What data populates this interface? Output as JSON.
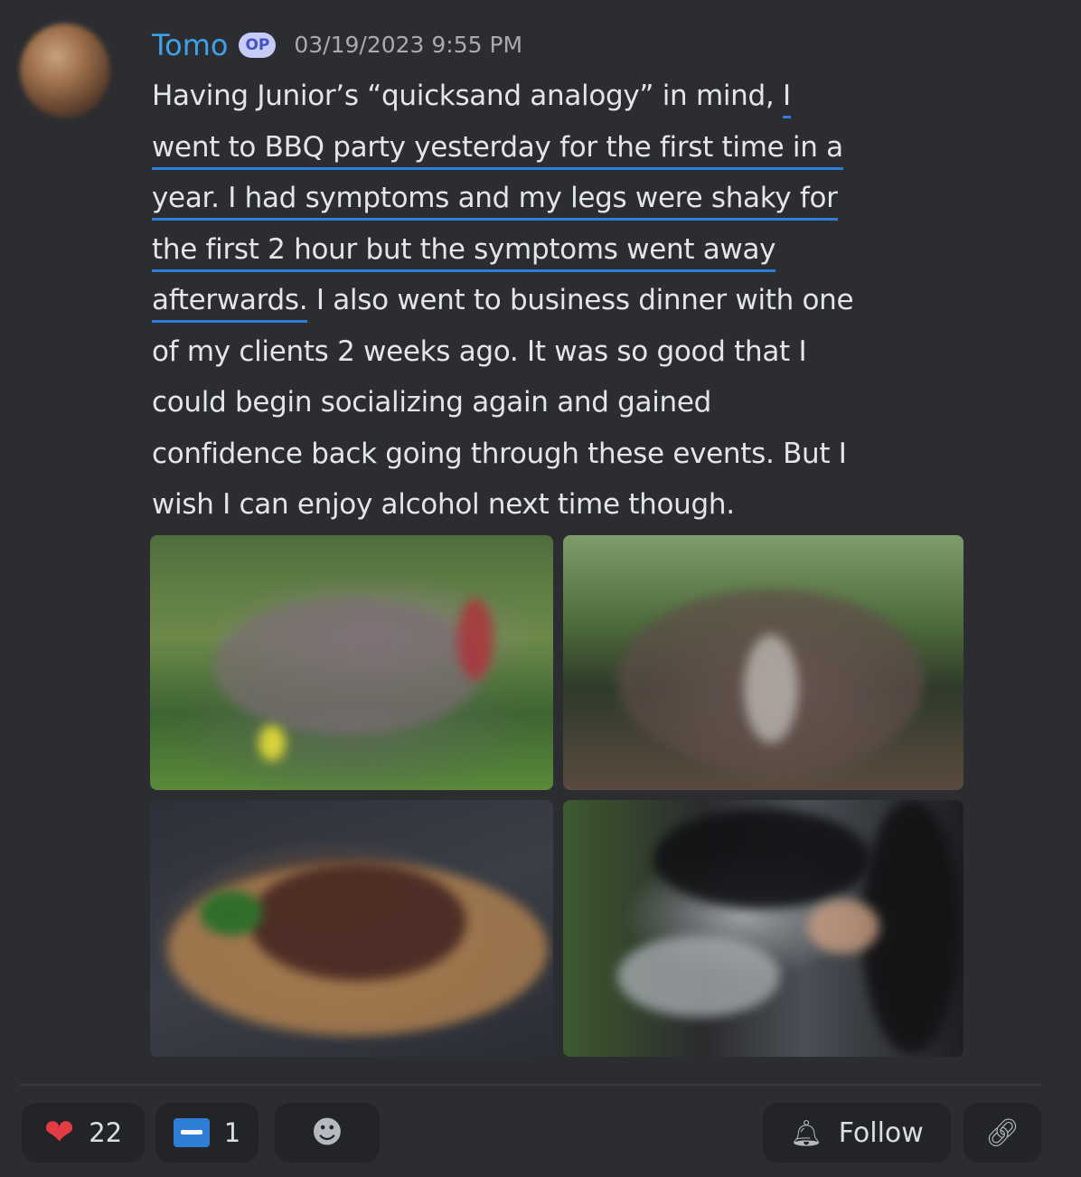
{
  "post": {
    "username": "Tomo",
    "badge": "OP",
    "timestamp": "03/19/2023 9:55 PM",
    "lines": [
      "Having Junior’s “quicksand analogy” in mind, ",
      "I",
      "went to BBQ party yesterday for the first time in a",
      "year. I had symptoms and my legs were shaky for",
      "the first 2 hour but the symptoms went away",
      "afterwards.",
      " I also went to business dinner with one",
      "of my clients 2 weeks ago. It was so good that I",
      "could begin socializing again and gained",
      "confidence back going through these events. But I",
      "wish I can enjoy alcohol next time though."
    ]
  },
  "reactions": {
    "heart_icon": "heart-icon",
    "heart_count": "22",
    "card_icon": "credit-card-icon",
    "card_count": "1",
    "add_reaction_icon": "add-reaction-icon"
  },
  "actions": {
    "follow_label": "Follow",
    "bell_icon": "bell-icon",
    "link_icon": "link-icon"
  }
}
